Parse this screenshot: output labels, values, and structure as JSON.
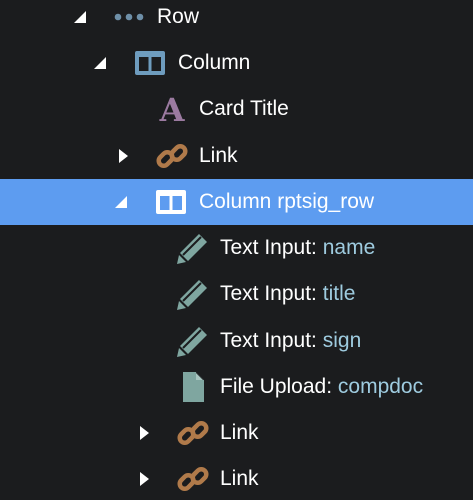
{
  "colors": {
    "background": "#1b1c1e",
    "selection": "#5d9cf0",
    "text": "#ffffff",
    "value_text": "#9ecbdf",
    "column_icon": "#6e9cbe",
    "title_icon": "#9b7aa0",
    "link_icon": "#b07a4a",
    "input_icon": "#7fa6a0"
  },
  "tree": [
    {
      "icon": "ellipsis-icon",
      "expander": "expanded",
      "label": "Row",
      "value": ""
    },
    {
      "icon": "columns-icon",
      "expander": "expanded",
      "label": "Column",
      "value": ""
    },
    {
      "icon": "letter-a-icon",
      "expander": "none",
      "label": "Card Title",
      "value": ""
    },
    {
      "icon": "link-icon",
      "expander": "collapsed",
      "label": "Link",
      "value": ""
    },
    {
      "icon": "columns-icon",
      "expander": "expanded",
      "label": "Column rptsig_row",
      "value": "",
      "selected": true
    },
    {
      "icon": "pencil-icon",
      "expander": "none",
      "label": "Text Input: ",
      "value": "name"
    },
    {
      "icon": "pencil-icon",
      "expander": "none",
      "label": "Text Input: ",
      "value": "title"
    },
    {
      "icon": "pencil-icon",
      "expander": "none",
      "label": "Text Input: ",
      "value": "sign"
    },
    {
      "icon": "file-icon",
      "expander": "none",
      "label": "File Upload: ",
      "value": "compdoc"
    },
    {
      "icon": "link-icon",
      "expander": "collapsed",
      "label": "Link",
      "value": ""
    },
    {
      "icon": "link-icon",
      "expander": "collapsed",
      "label": "Link",
      "value": ""
    }
  ]
}
